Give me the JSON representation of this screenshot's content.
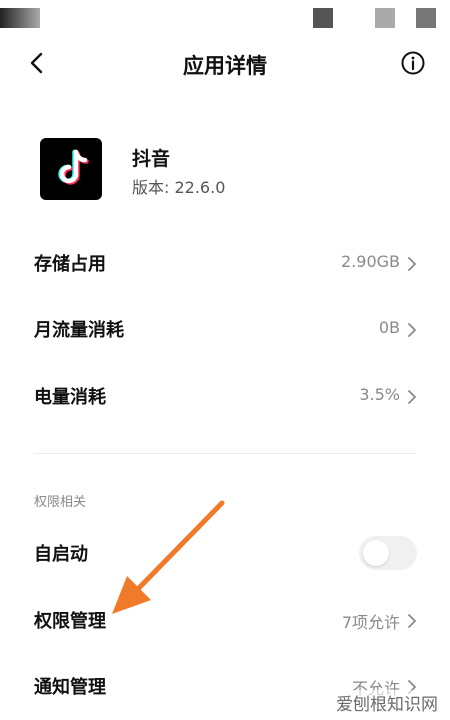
{
  "topbar": {
    "title": "应用详情"
  },
  "app": {
    "name": "抖音",
    "version": "版本: 22.6.0"
  },
  "usage": [
    {
      "label": "存储占用",
      "value": "2.90GB"
    },
    {
      "label": "月流量消耗",
      "value": "0B"
    },
    {
      "label": "电量消耗",
      "value": "3.5%"
    }
  ],
  "permissions": {
    "section_title": "权限相关",
    "auto_start": {
      "label": "自启动",
      "enabled": false
    },
    "perm_manage": {
      "label": "权限管理",
      "value": "7项允许"
    },
    "notify": {
      "label": "通知管理",
      "value": "不允许"
    }
  },
  "watermark": "爱刨根知识网",
  "colors": {
    "arrow": "#f07a2a",
    "secondary_text": "#8a8a8a"
  }
}
